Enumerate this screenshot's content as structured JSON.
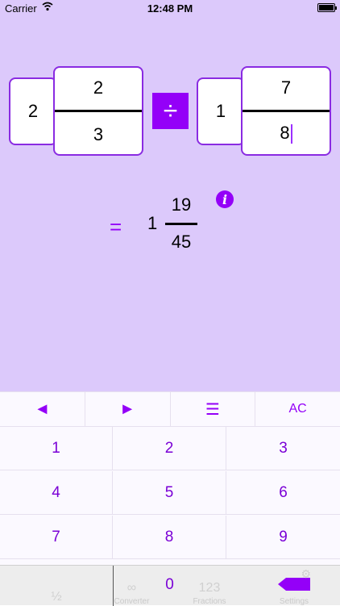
{
  "status": {
    "carrier": "Carrier",
    "time": "12:48 PM"
  },
  "left_operand": {
    "whole": "2",
    "numerator": "2",
    "denominator": "3"
  },
  "operator": "÷",
  "right_operand": {
    "whole": "1",
    "numerator": "7",
    "denominator": "8"
  },
  "result": {
    "equals": "=",
    "whole": "1",
    "numerator": "19",
    "denominator": "45"
  },
  "info_icon": "i",
  "toolbar": {
    "left": "◄",
    "right": "►",
    "menu": "☰",
    "clear": "AC"
  },
  "keys": [
    "1",
    "2",
    "3",
    "4",
    "5",
    "6",
    "7",
    "8",
    "9",
    "0"
  ],
  "tabs": [
    {
      "icon": "½",
      "label": ""
    },
    {
      "icon": "∞",
      "label": "Converter"
    },
    {
      "icon": "123",
      "label": "Fractions"
    },
    {
      "icon": "⚙",
      "label": "Settings"
    }
  ],
  "colors": {
    "accent": "#9400f8",
    "background": "#dcc9fb"
  }
}
